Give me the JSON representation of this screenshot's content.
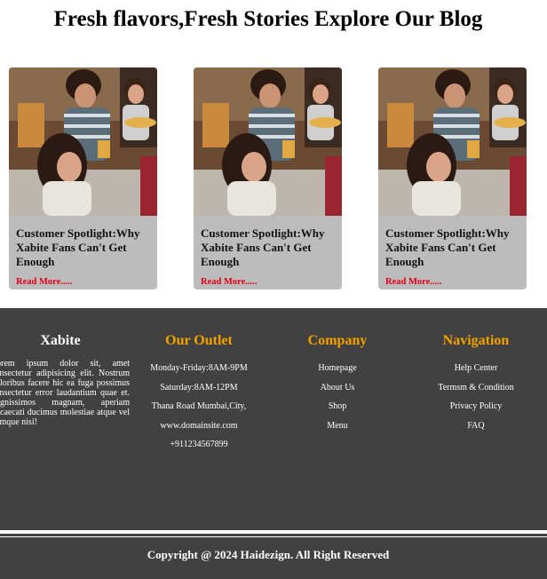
{
  "heading": "Fresh flavors,Fresh Stories Explore Our Blog",
  "cards": [
    {
      "title": "Customer Spotlight:Why Xabite Fans Can't Get Enough",
      "link": "Read More....."
    },
    {
      "title": "Customer Spotlight:Why Xabite Fans Can't Get Enough",
      "link": "Read More....."
    },
    {
      "title": "Customer Spotlight:Why Xabite Fans Can't Get Enough",
      "link": "Read More....."
    }
  ],
  "footer": {
    "brand": {
      "title": "Xabite",
      "text": "Lorem ipsum dolor sit, amet consectetur adipisicing elit. Nostrum doloribus facere hic ea fuga possimus consectetur error laudantium quae et. Dignissimos magnam, aperiam obcaecati ducimus molestiae atque vel cumque nisi!"
    },
    "outlet": {
      "title": "Our Outlet",
      "lines": [
        "Monday-Friday:8AM-9PM",
        "Saturday:8AM-12PM",
        "Thana Road Mumbai,City,",
        "www.domainsite.com",
        "+911234567899"
      ]
    },
    "company": {
      "title": "Company",
      "links": [
        "Homepage",
        "About Us",
        "Shop",
        "Menu"
      ]
    },
    "navigation": {
      "title": "Navigation",
      "links": [
        "Help Center",
        "Termsm & Condition",
        "Privacy Policy",
        "FAQ"
      ]
    },
    "copyright": "Copyright @ 2024 Haidezign. All Right Reserved"
  },
  "colors": {
    "accent": "#f4a100",
    "link": "#e2000f",
    "footer_bg": "#414141",
    "card_bg": "#bdbcbc"
  }
}
